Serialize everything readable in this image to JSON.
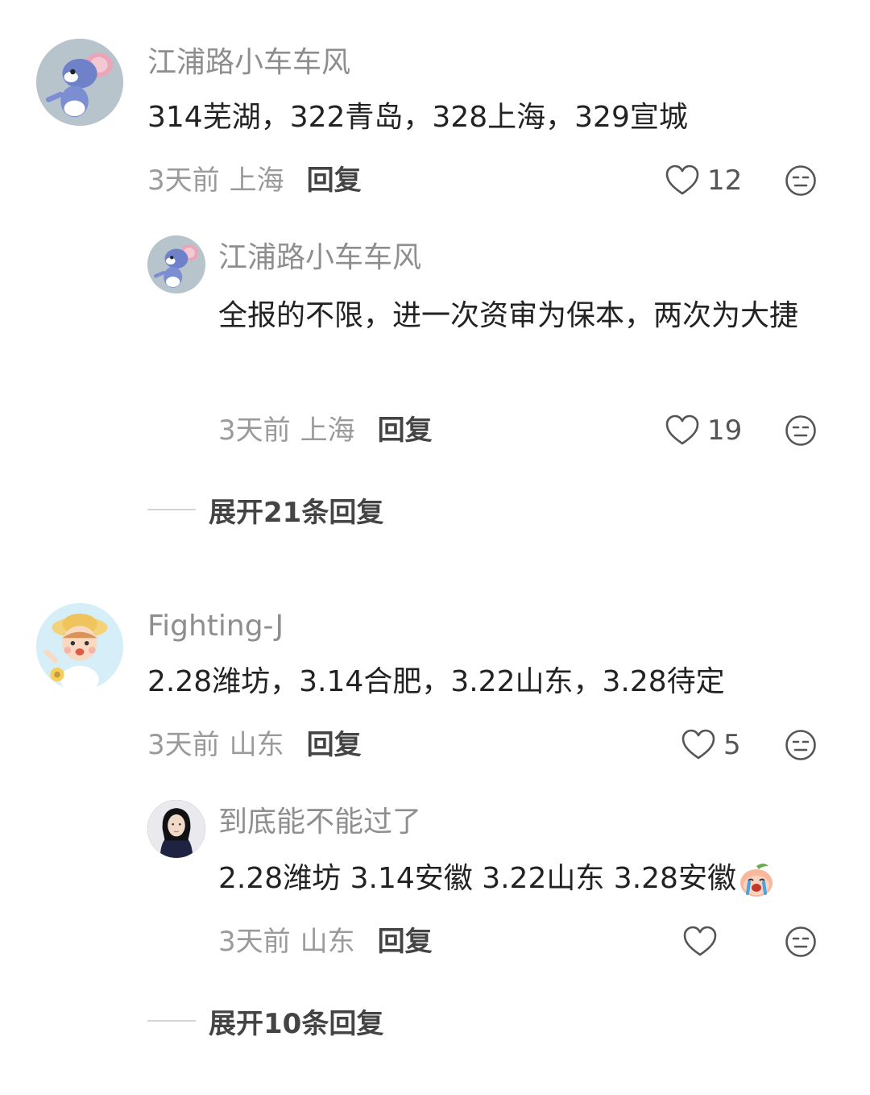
{
  "comments": [
    {
      "username": "江浦路小车车风",
      "text": "314芜湖，322青岛，328上海，329宣城",
      "time": "3天前",
      "location": "上海",
      "reply": "回复",
      "likes": "12",
      "avatar": "cartoon-mouse-avatar",
      "replies": [
        {
          "username": "江浦路小车车风",
          "text": "全报的不限，进一次资审为保本，两次为大捷",
          "time": "3天前",
          "location": "上海",
          "reply": "回复",
          "likes": "19",
          "avatar": "cartoon-mouse-avatar"
        }
      ],
      "expand": "展开21条回复"
    },
    {
      "username": "Fighting-J",
      "text": "2.28潍坊，3.14合肥，3.22山东，3.28待定",
      "time": "3天前",
      "location": "山东",
      "reply": "回复",
      "likes": "5",
      "avatar": "cartoon-girl-avatar",
      "replies": [
        {
          "username": "到底能不能过了",
          "text": "2.28潍坊 3.14安徽 3.22山东 3.28安徽",
          "time": "3天前",
          "location": "山东",
          "reply": "回复",
          "likes": "",
          "avatar": "person-photo-avatar",
          "emoji": "crying-peach-emoji"
        }
      ],
      "expand": "展开10条回复"
    }
  ]
}
